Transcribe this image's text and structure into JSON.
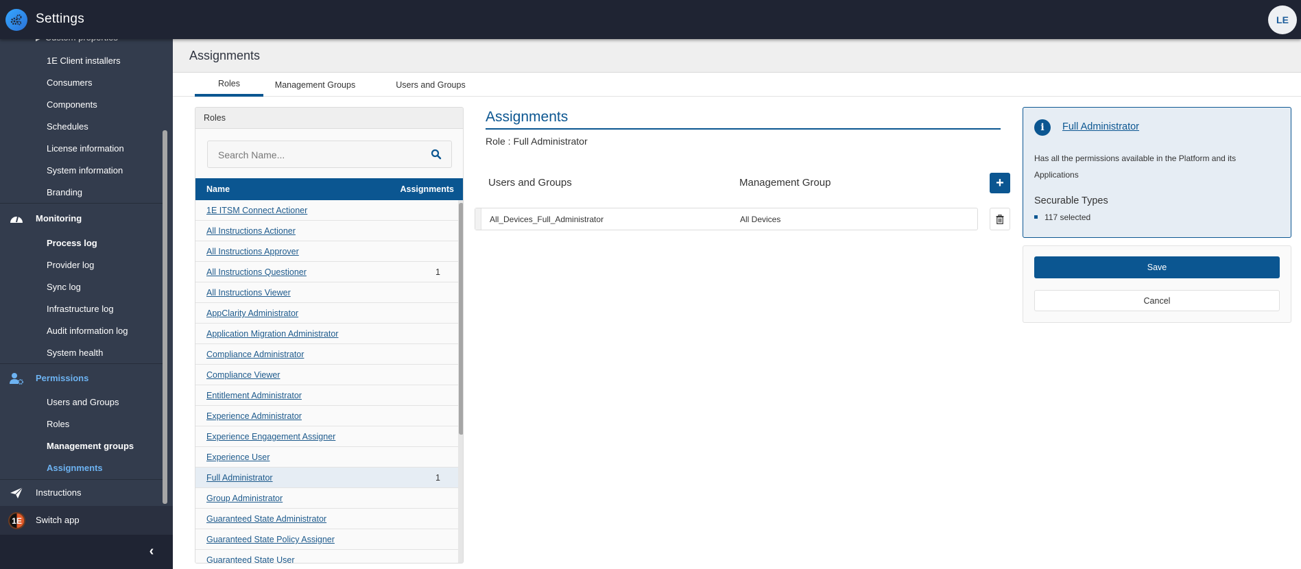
{
  "app": {
    "title": "Settings",
    "user_initials": "LE"
  },
  "sidebar": {
    "settings_items": [
      {
        "label": "Custom properties"
      },
      {
        "label": "1E Client installers"
      },
      {
        "label": "Consumers"
      },
      {
        "label": "Components"
      },
      {
        "label": "Schedules"
      },
      {
        "label": "License information"
      },
      {
        "label": "System information"
      },
      {
        "label": "Branding"
      }
    ],
    "monitoring": {
      "label": "Monitoring",
      "items": [
        {
          "label": "Process log"
        },
        {
          "label": "Provider log"
        },
        {
          "label": "Sync log"
        },
        {
          "label": "Infrastructure log"
        },
        {
          "label": "Audit information log"
        },
        {
          "label": "System health"
        }
      ]
    },
    "permissions": {
      "label": "Permissions",
      "items": [
        {
          "label": "Users and Groups"
        },
        {
          "label": "Roles"
        },
        {
          "label": "Management groups"
        },
        {
          "label": "Assignments"
        }
      ]
    },
    "instructions": {
      "label": "Instructions"
    },
    "switch_app": {
      "label": "Switch app",
      "icon_text": "1E"
    },
    "collapse_icon": "chevron-left"
  },
  "page": {
    "title": "Assignments"
  },
  "tabs": [
    {
      "label": "Roles",
      "active": true
    },
    {
      "label": "Management Groups",
      "active": false
    },
    {
      "label": "Users and Groups",
      "active": false
    }
  ],
  "roles_panel": {
    "title": "Roles",
    "search_placeholder": "Search Name...",
    "columns": {
      "name": "Name",
      "assignments": "Assignments"
    },
    "rows": [
      {
        "name": "1E ITSM Connect Actioner",
        "count": ""
      },
      {
        "name": "All Instructions Actioner",
        "count": ""
      },
      {
        "name": "All Instructions Approver",
        "count": ""
      },
      {
        "name": "All Instructions Questioner",
        "count": "1"
      },
      {
        "name": "All Instructions Viewer",
        "count": ""
      },
      {
        "name": "AppClarity Administrator",
        "count": ""
      },
      {
        "name": "Application Migration Administrator",
        "count": ""
      },
      {
        "name": "Compliance Administrator",
        "count": ""
      },
      {
        "name": "Compliance Viewer",
        "count": ""
      },
      {
        "name": "Entitlement Administrator",
        "count": ""
      },
      {
        "name": "Experience Administrator",
        "count": ""
      },
      {
        "name": "Experience Engagement Assigner",
        "count": ""
      },
      {
        "name": "Experience User",
        "count": ""
      },
      {
        "name": "Full Administrator",
        "count": "1",
        "selected": true
      },
      {
        "name": "Group Administrator",
        "count": ""
      },
      {
        "name": "Guaranteed State Administrator",
        "count": ""
      },
      {
        "name": "Guaranteed State Policy Assigner",
        "count": ""
      },
      {
        "name": "Guaranteed State User",
        "count": ""
      }
    ]
  },
  "assignments": {
    "title": "Assignments",
    "role_label": "Role : Full Administrator",
    "col_users": "Users and Groups",
    "col_mg": "Management Group",
    "add_label": "+",
    "rows": [
      {
        "user": "All_Devices_Full_Administrator",
        "management_group": "All Devices"
      }
    ]
  },
  "info_card": {
    "title": "Full Administrator",
    "description": "Has all the permissions available in the Platform and its Applications",
    "securable_title": "Securable Types",
    "securable_item": "117 selected"
  },
  "actions": {
    "save": "Save",
    "cancel": "Cancel"
  },
  "colors": {
    "brand": "#0b5691",
    "sidebar": "#333c4d",
    "topbar": "#1f2433",
    "active_link": "#6db3f2"
  }
}
